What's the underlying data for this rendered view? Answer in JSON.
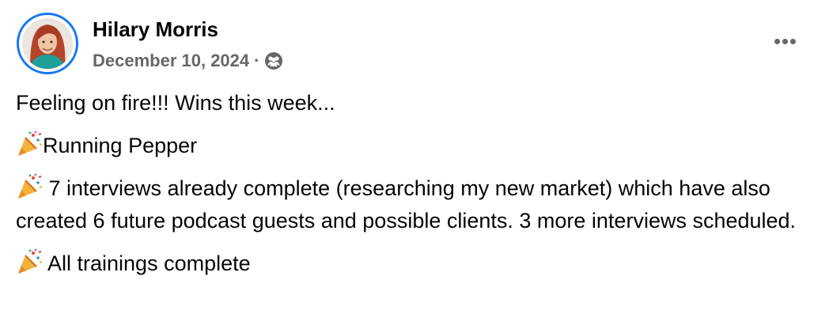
{
  "post": {
    "author": "Hilary Morris",
    "date": "December 10, 2024",
    "separator": "·",
    "audience_icon": "friends-icon",
    "more_icon": "more-options-icon",
    "lines": [
      {
        "emoji": "",
        "text": "Feeling on fire!!! Wins this week..."
      },
      {
        "emoji": "party-popper-icon",
        "text": "Running Pepper"
      },
      {
        "emoji": "party-popper-icon",
        "text": " 7 interviews already complete (researching my new market) which have also created 6 future podcast guests and possible clients. 3 more interviews scheduled."
      },
      {
        "emoji": "party-popper-icon",
        "text": " All trainings complete"
      }
    ]
  },
  "colors": {
    "ring": "#1877f2",
    "text": "#050505",
    "meta": "#65676b"
  }
}
